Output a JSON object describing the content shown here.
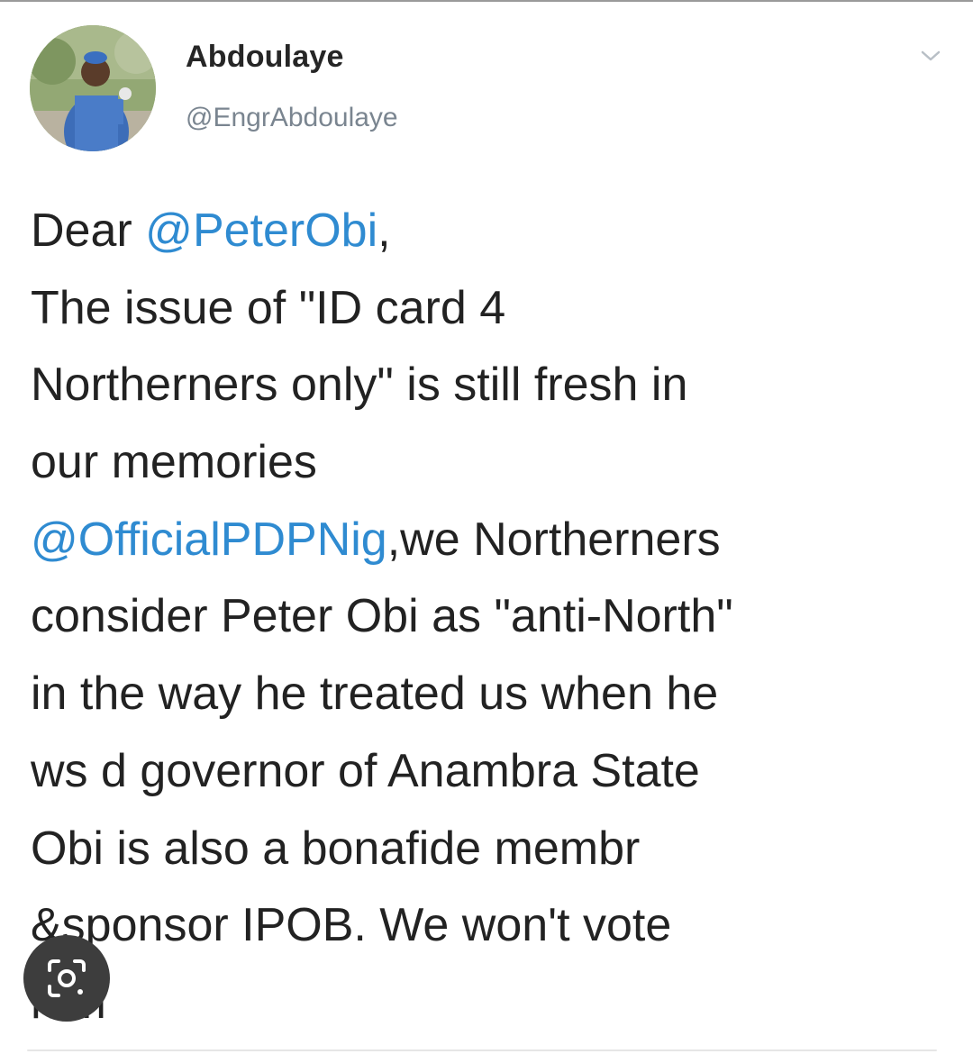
{
  "tweet": {
    "author": {
      "display_name": "Abdoulaye",
      "handle": "@EngrAbdoulaye"
    },
    "menu_icon": "chevron-down-icon",
    "lines": [
      [
        {
          "text": "Dear "
        },
        {
          "text": "@PeterObi",
          "mention": true
        },
        {
          "text": ","
        }
      ],
      [
        {
          "text": "The issue of \"ID card 4"
        }
      ],
      [
        {
          "text": "Northerners only\" is still fresh in"
        }
      ],
      [
        {
          "text": "our memories"
        }
      ],
      [
        {
          "text": "@OfficialPDPNig",
          "mention": true
        },
        {
          "text": ",we Northerners"
        }
      ],
      [
        {
          "text": "consider Peter Obi as \"anti-North\""
        }
      ],
      [
        {
          "text": "in the way he treated us when he"
        }
      ],
      [
        {
          "text": "ws d governor of Anambra State"
        }
      ],
      [
        {
          "text": "Obi is also a bonafide membr"
        }
      ],
      [
        {
          "text": "&sponsor IPOB. We won't vote"
        }
      ],
      [
        {
          "text": "him"
        }
      ]
    ]
  },
  "overlay": {
    "lens_icon": "google-lens-icon"
  },
  "colors": {
    "mention": "#2f8bd1",
    "text": "#222222",
    "handle": "#7a8590",
    "lens_button": "#3d3d3d"
  }
}
